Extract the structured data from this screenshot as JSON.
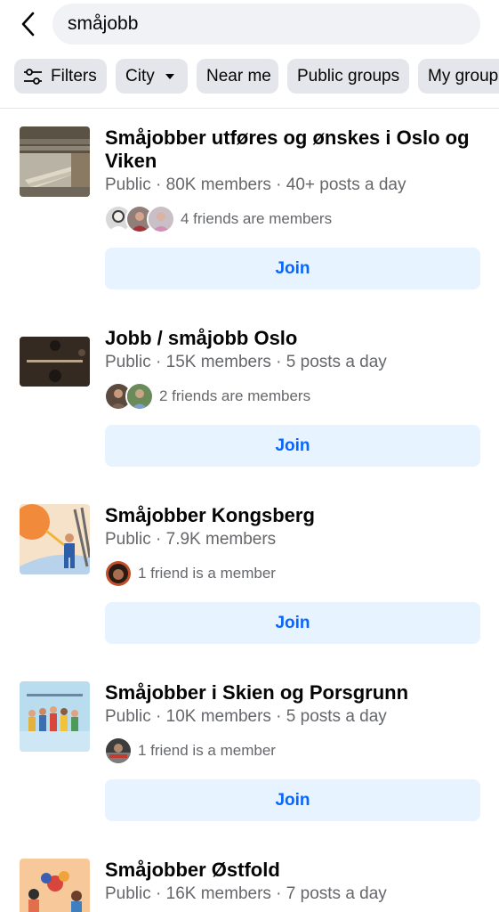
{
  "search": {
    "query": "småjobb"
  },
  "filters": {
    "items": [
      {
        "label": "Filters",
        "icon": "sliders-icon"
      },
      {
        "label": "City",
        "icon": "caret-down-icon"
      },
      {
        "label": "Near me"
      },
      {
        "label": "Public groups"
      },
      {
        "label": "My groups"
      }
    ]
  },
  "colors": {
    "accent": "#0866ff",
    "join_bg": "#e7f3ff",
    "chip_bg": "#e4e6eb",
    "search_bg": "#f0f2f5",
    "secondary_text": "#65676b"
  },
  "groups": [
    {
      "name": "Småjobber utføres og ønskes i Oslo og Viken",
      "meta": "Public · 80K members · 40+ posts a day",
      "friends": "4 friends are members",
      "join": "Join"
    },
    {
      "name": "Jobb / småjobb Oslo",
      "meta": "Public · 15K members · 5 posts a day",
      "friends": "2 friends are members",
      "join": "Join"
    },
    {
      "name": "Småjobber Kongsberg",
      "meta": "Public · 7.9K members",
      "friends": "1 friend is a member",
      "join": "Join"
    },
    {
      "name": "Småjobber i Skien og Porsgrunn",
      "meta": "Public · 10K members · 5 posts a day",
      "friends": "1 friend is a member",
      "join": "Join"
    },
    {
      "name": "Småjobber Østfold",
      "meta": "Public · 16K members · 7 posts a day"
    }
  ]
}
